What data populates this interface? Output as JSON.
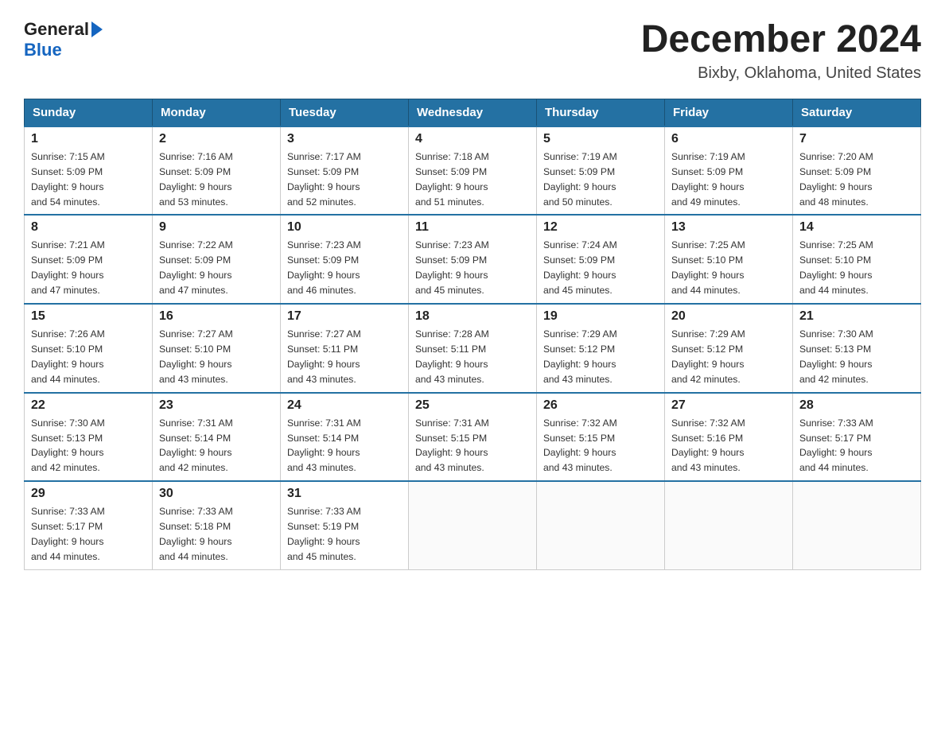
{
  "header": {
    "logo_general": "General",
    "logo_blue": "Blue",
    "month_title": "December 2024",
    "location": "Bixby, Oklahoma, United States"
  },
  "days_of_week": [
    "Sunday",
    "Monday",
    "Tuesday",
    "Wednesday",
    "Thursday",
    "Friday",
    "Saturday"
  ],
  "weeks": [
    [
      {
        "num": "1",
        "sunrise": "7:15 AM",
        "sunset": "5:09 PM",
        "daylight_h": "9",
        "daylight_m": "54"
      },
      {
        "num": "2",
        "sunrise": "7:16 AM",
        "sunset": "5:09 PM",
        "daylight_h": "9",
        "daylight_m": "53"
      },
      {
        "num": "3",
        "sunrise": "7:17 AM",
        "sunset": "5:09 PM",
        "daylight_h": "9",
        "daylight_m": "52"
      },
      {
        "num": "4",
        "sunrise": "7:18 AM",
        "sunset": "5:09 PM",
        "daylight_h": "9",
        "daylight_m": "51"
      },
      {
        "num": "5",
        "sunrise": "7:19 AM",
        "sunset": "5:09 PM",
        "daylight_h": "9",
        "daylight_m": "50"
      },
      {
        "num": "6",
        "sunrise": "7:19 AM",
        "sunset": "5:09 PM",
        "daylight_h": "9",
        "daylight_m": "49"
      },
      {
        "num": "7",
        "sunrise": "7:20 AM",
        "sunset": "5:09 PM",
        "daylight_h": "9",
        "daylight_m": "48"
      }
    ],
    [
      {
        "num": "8",
        "sunrise": "7:21 AM",
        "sunset": "5:09 PM",
        "daylight_h": "9",
        "daylight_m": "47"
      },
      {
        "num": "9",
        "sunrise": "7:22 AM",
        "sunset": "5:09 PM",
        "daylight_h": "9",
        "daylight_m": "47"
      },
      {
        "num": "10",
        "sunrise": "7:23 AM",
        "sunset": "5:09 PM",
        "daylight_h": "9",
        "daylight_m": "46"
      },
      {
        "num": "11",
        "sunrise": "7:23 AM",
        "sunset": "5:09 PM",
        "daylight_h": "9",
        "daylight_m": "45"
      },
      {
        "num": "12",
        "sunrise": "7:24 AM",
        "sunset": "5:09 PM",
        "daylight_h": "9",
        "daylight_m": "45"
      },
      {
        "num": "13",
        "sunrise": "7:25 AM",
        "sunset": "5:10 PM",
        "daylight_h": "9",
        "daylight_m": "44"
      },
      {
        "num": "14",
        "sunrise": "7:25 AM",
        "sunset": "5:10 PM",
        "daylight_h": "9",
        "daylight_m": "44"
      }
    ],
    [
      {
        "num": "15",
        "sunrise": "7:26 AM",
        "sunset": "5:10 PM",
        "daylight_h": "9",
        "daylight_m": "44"
      },
      {
        "num": "16",
        "sunrise": "7:27 AM",
        "sunset": "5:10 PM",
        "daylight_h": "9",
        "daylight_m": "43"
      },
      {
        "num": "17",
        "sunrise": "7:27 AM",
        "sunset": "5:11 PM",
        "daylight_h": "9",
        "daylight_m": "43"
      },
      {
        "num": "18",
        "sunrise": "7:28 AM",
        "sunset": "5:11 PM",
        "daylight_h": "9",
        "daylight_m": "43"
      },
      {
        "num": "19",
        "sunrise": "7:29 AM",
        "sunset": "5:12 PM",
        "daylight_h": "9",
        "daylight_m": "43"
      },
      {
        "num": "20",
        "sunrise": "7:29 AM",
        "sunset": "5:12 PM",
        "daylight_h": "9",
        "daylight_m": "42"
      },
      {
        "num": "21",
        "sunrise": "7:30 AM",
        "sunset": "5:13 PM",
        "daylight_h": "9",
        "daylight_m": "42"
      }
    ],
    [
      {
        "num": "22",
        "sunrise": "7:30 AM",
        "sunset": "5:13 PM",
        "daylight_h": "9",
        "daylight_m": "42"
      },
      {
        "num": "23",
        "sunrise": "7:31 AM",
        "sunset": "5:14 PM",
        "daylight_h": "9",
        "daylight_m": "42"
      },
      {
        "num": "24",
        "sunrise": "7:31 AM",
        "sunset": "5:14 PM",
        "daylight_h": "9",
        "daylight_m": "43"
      },
      {
        "num": "25",
        "sunrise": "7:31 AM",
        "sunset": "5:15 PM",
        "daylight_h": "9",
        "daylight_m": "43"
      },
      {
        "num": "26",
        "sunrise": "7:32 AM",
        "sunset": "5:15 PM",
        "daylight_h": "9",
        "daylight_m": "43"
      },
      {
        "num": "27",
        "sunrise": "7:32 AM",
        "sunset": "5:16 PM",
        "daylight_h": "9",
        "daylight_m": "43"
      },
      {
        "num": "28",
        "sunrise": "7:33 AM",
        "sunset": "5:17 PM",
        "daylight_h": "9",
        "daylight_m": "44"
      }
    ],
    [
      {
        "num": "29",
        "sunrise": "7:33 AM",
        "sunset": "5:17 PM",
        "daylight_h": "9",
        "daylight_m": "44"
      },
      {
        "num": "30",
        "sunrise": "7:33 AM",
        "sunset": "5:18 PM",
        "daylight_h": "9",
        "daylight_m": "44"
      },
      {
        "num": "31",
        "sunrise": "7:33 AM",
        "sunset": "5:19 PM",
        "daylight_h": "9",
        "daylight_m": "45"
      },
      null,
      null,
      null,
      null
    ]
  ]
}
